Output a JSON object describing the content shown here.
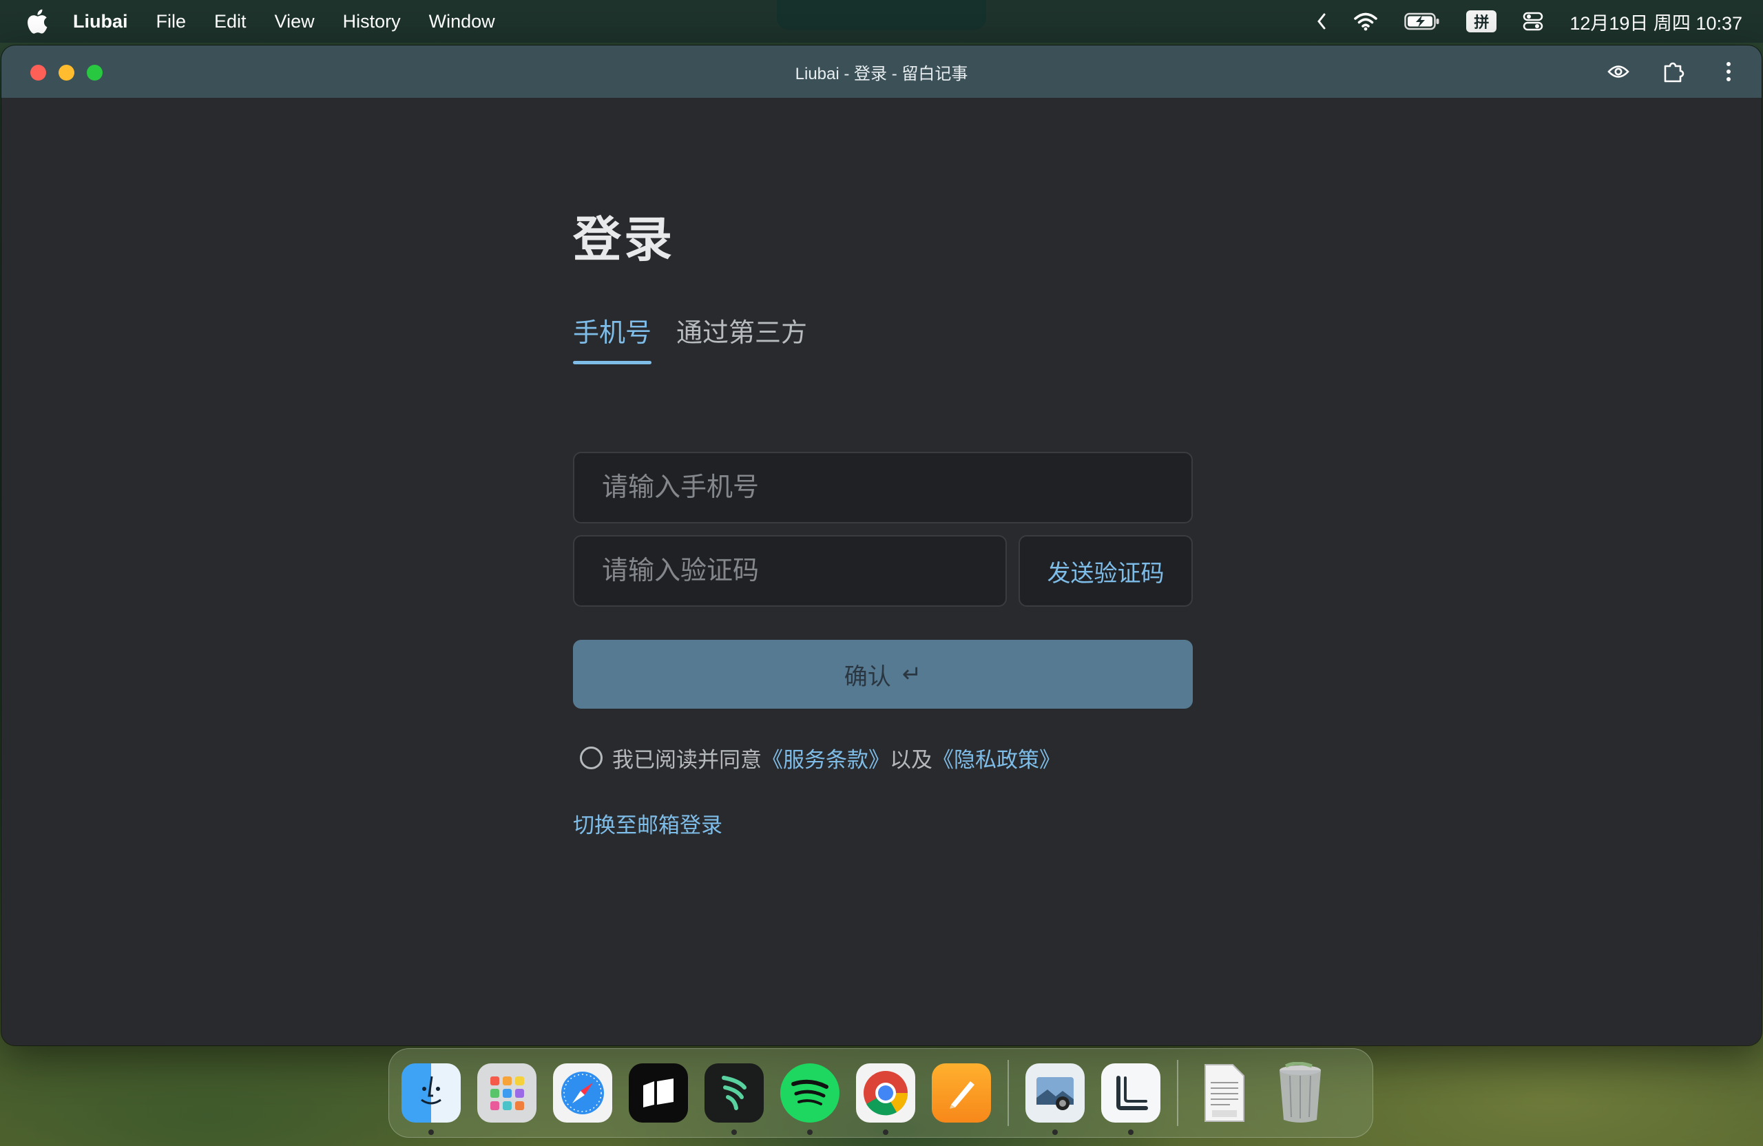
{
  "menubar": {
    "app_name": "Liubai",
    "items": [
      "File",
      "Edit",
      "View",
      "History",
      "Window"
    ],
    "input_method": "拼",
    "clock": "12月19日 周四  10:37",
    "icons": [
      "apple-icon",
      "chevron-left-icon",
      "wifi-icon",
      "battery-charging-icon",
      "control-center-icon"
    ]
  },
  "window": {
    "title": "Liubai - 登录 - 留白记事",
    "toolbar_icons": [
      "eye-icon",
      "extension-icon",
      "more-vertical-icon"
    ]
  },
  "login": {
    "heading": "登录",
    "tabs": [
      {
        "label": "手机号",
        "active": true
      },
      {
        "label": "通过第三方",
        "active": false
      }
    ],
    "phone_placeholder": "请输入手机号",
    "code_placeholder": "请输入验证码",
    "send_code_label": "发送验证码",
    "confirm_label": "确认",
    "confirm_icon": "↵",
    "agreement": {
      "prefix": "我已阅读并同意",
      "terms": "《服务条款》",
      "middle": "以及",
      "privacy": "《隐私政策》",
      "checked": false
    },
    "switch_link": "切换至邮箱登录"
  },
  "dock": {
    "apps": [
      "finder-icon",
      "launchpad-icon",
      "safari-icon",
      "notes-app-icon",
      "reeder-icon",
      "spotify-icon",
      "chrome-icon",
      "pages-icon",
      "preview-icon",
      "liubai-app-icon",
      "document-icon",
      "trash-icon"
    ]
  },
  "colors": {
    "accent": "#7fbde9",
    "confirm_button": "#577a93",
    "window_bg": "#292a2d",
    "titlebar": "#3b5057"
  }
}
